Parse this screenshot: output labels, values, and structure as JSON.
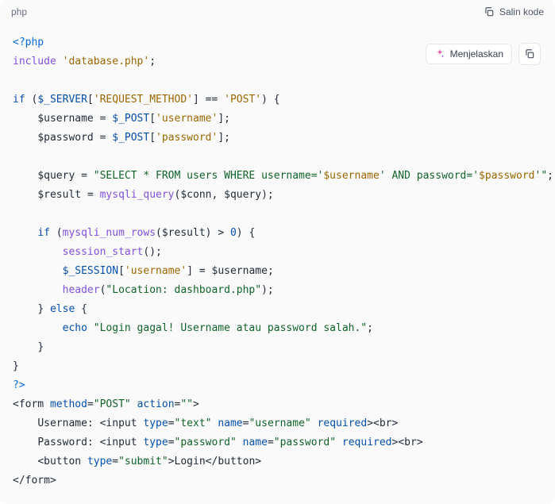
{
  "header": {
    "language": "php",
    "copy_label": "Salin kode"
  },
  "buttons": {
    "explain_label": "Menjelaskan"
  },
  "code": {
    "l1_open": "<?php",
    "l2_include": "include",
    "l2_file": "'database.php'",
    "l4_if": "if",
    "l4_server": "$_SERVER",
    "l4_reqmethod": "'REQUEST_METHOD'",
    "l4_eq": "==",
    "l4_post": "'POST'",
    "l5_username": "$username",
    "l5_postvar": "$_POST",
    "l5_userkey": "'username'",
    "l6_password": "$password",
    "l6_postvar": "$_POST",
    "l6_passkey": "'password'",
    "l8_query": "$query",
    "l8_sql1": "\"SELECT * FROM users WHERE username='",
    "l8_uservar": "$username",
    "l8_sql2": "' AND password='",
    "l8_passvar": "$password",
    "l8_sql3": "'\"",
    "l9_result": "$result",
    "l9_mysqli": "mysqli_query",
    "l9_conn": "$conn",
    "l9_queryvar": "$query",
    "l11_if": "if",
    "l11_numrows": "mysqli_num_rows",
    "l11_resultvar": "$result",
    "l11_gt": ">",
    "l11_zero": "0",
    "l12_session": "session_start",
    "l13_session": "$_SESSION",
    "l13_userkey": "'username'",
    "l13_uservar": "$username",
    "l14_header": "header",
    "l14_loc": "\"Location: dashboard.php\"",
    "l15_else": "else",
    "l16_echo": "echo",
    "l16_msg": "\"Login gagal! Username atau password salah.\"",
    "l19_close": "?>",
    "l20_form": "form",
    "l20_method": "method",
    "l20_methodval": "\"POST\"",
    "l20_action": "action",
    "l20_actionval": "\"\"",
    "l21_label": "Username: ",
    "l21_input": "input",
    "l21_type": "type",
    "l21_typeval": "\"text\"",
    "l21_name": "name",
    "l21_nameval": "\"username\"",
    "l21_required": "required",
    "l21_br": "br",
    "l22_label": "Password: ",
    "l22_input": "input",
    "l22_type": "type",
    "l22_typeval": "\"password\"",
    "l22_name": "name",
    "l22_nameval": "\"password\"",
    "l22_required": "required",
    "l22_br": "br",
    "l23_button": "button",
    "l23_type": "type",
    "l23_typeval": "\"submit\"",
    "l23_text": "Login",
    "l24_form": "form"
  }
}
